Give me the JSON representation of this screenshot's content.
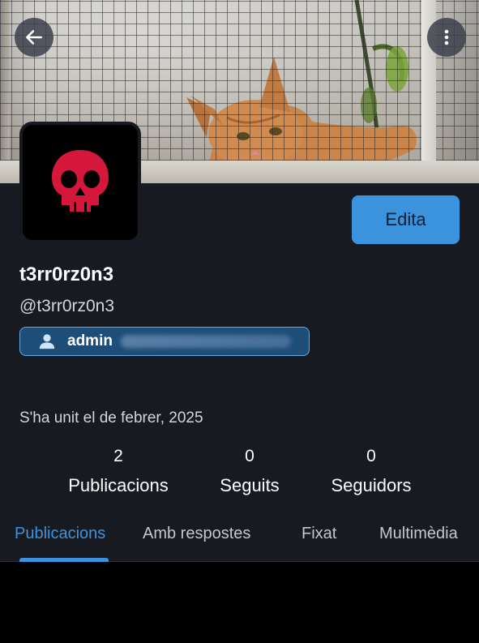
{
  "profile": {
    "display_name": "t3rr0rz0n3",
    "handle": "@t3rr0rz0n3",
    "role": "admin",
    "joined": "S'ha unit el de febrer, 2025"
  },
  "actions": {
    "edit_label": "Edita"
  },
  "stats": [
    {
      "count": "2",
      "label": "Publicacions"
    },
    {
      "count": "0",
      "label": "Seguits"
    },
    {
      "count": "0",
      "label": "Seguidors"
    }
  ],
  "tabs": [
    {
      "label": "Publicacions",
      "active": true
    },
    {
      "label": "Amb respostes",
      "active": false
    },
    {
      "label": "Fixat",
      "active": false
    },
    {
      "label": "Multimèdia",
      "active": false
    }
  ],
  "icons": {
    "back": "arrow-left-icon",
    "menu": "more-vertical-icon",
    "avatar": "skull-icon",
    "role": "user-icon"
  },
  "colors": {
    "accent": "#3b93dd",
    "background": "#181a21",
    "avatar_skull": "#d4173a"
  }
}
